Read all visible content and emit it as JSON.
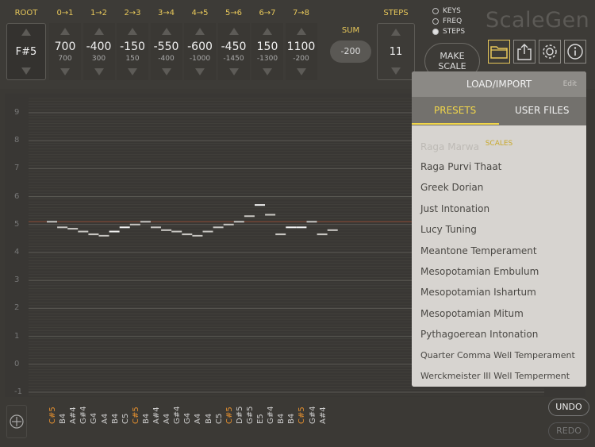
{
  "header": {
    "root_label": "ROOT",
    "root_value": "F#5",
    "interval_labels": [
      "0→1",
      "1→2",
      "2→3",
      "3→4",
      "4→5",
      "5→6",
      "6→7",
      "7→8"
    ],
    "interval_values": [
      "700",
      "-400",
      "-150",
      "-550",
      "-600",
      "-450",
      "150",
      "1100"
    ],
    "interval_subvalues": [
      "700",
      "300",
      "150",
      "-400",
      "-1000",
      "-1450",
      "-1300",
      "-200"
    ],
    "sum_label": "SUM",
    "sum_value": "-200",
    "steps_label": "STEPS",
    "steps_value": "11",
    "radio_options": [
      {
        "label": "KEYS",
        "selected": false
      },
      {
        "label": "FREQ",
        "selected": false
      },
      {
        "label": "STEPS",
        "selected": true
      }
    ],
    "make_scale_line1": "MAKE",
    "make_scale_line2": "SCALE",
    "app_title": "ScaleGen",
    "icons": [
      "folder-icon",
      "share-icon",
      "gear-icon",
      "info-icon"
    ]
  },
  "grid": {
    "y_axis_labels": [
      "9",
      "8",
      "7",
      "6",
      "5",
      "4",
      "3",
      "2",
      "1",
      "0",
      "-1"
    ],
    "reference_value": 5.1,
    "note_levels": [
      5.1,
      4.9,
      4.85,
      4.75,
      4.65,
      4.6,
      4.75,
      4.9,
      5.0,
      5.1,
      4.9,
      4.8,
      4.75,
      4.65,
      4.6,
      4.75,
      4.9,
      5.0,
      5.1,
      5.3,
      5.7,
      5.35,
      4.65,
      4.9,
      4.9,
      5.1,
      4.65,
      4.8
    ]
  },
  "notes": {
    "labels": [
      "C#5",
      "B4",
      "A#4",
      "G#4",
      "G4",
      "A4",
      "B4",
      "C5",
      "C#5",
      "B4",
      "A#4",
      "A4",
      "G#4",
      "G4",
      "A4",
      "B4",
      "C5",
      "C#5",
      "D#5",
      "G#5",
      "E5",
      "G#4",
      "B4",
      "B4",
      "C#5",
      "G#4",
      "A#4"
    ],
    "orange_indices": [
      0,
      8,
      17,
      24
    ],
    "undo_label": "UNDO",
    "redo_label": "REDO"
  },
  "popover": {
    "title": "LOAD/IMPORT",
    "edit_label": "Edit",
    "tab_presets": "PRESETS",
    "tab_user_files": "USER FILES",
    "section_label": "SCALES",
    "faded_item": "Raga Marwa",
    "items": [
      "Raga Purvi Thaat",
      "Greek Dorian",
      "Just Intonation",
      "Lucy Tuning",
      "Meantone Temperament",
      "Mesopotamian Embulum",
      "Mesopotamian Ishartum",
      "Mesopotamian Mitum",
      "Pythagoerean Intonation",
      "Quarter Comma Well Temperament",
      "Werckmeister III Well Temperment"
    ]
  },
  "colors": {
    "accent": "#e8c85a",
    "orange_note": "#e38f2f",
    "reference_line": "#8c4a33"
  }
}
